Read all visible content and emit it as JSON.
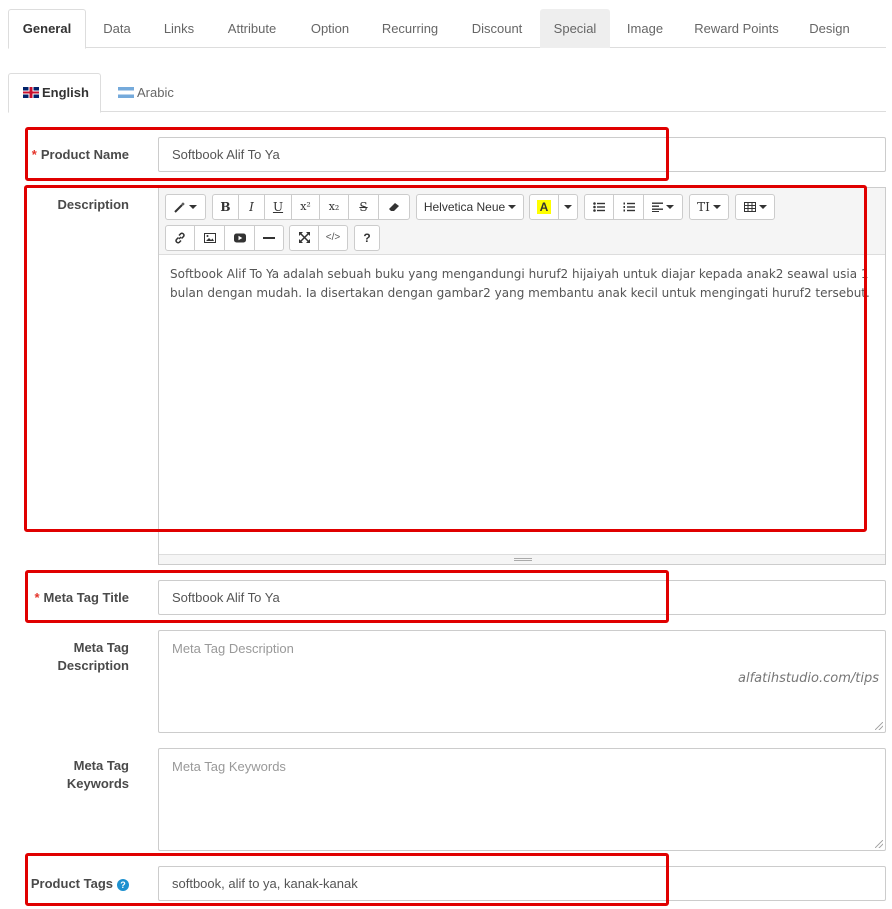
{
  "tabs": [
    {
      "label": "General",
      "active": true
    },
    {
      "label": "Data"
    },
    {
      "label": "Links"
    },
    {
      "label": "Attribute"
    },
    {
      "label": "Option"
    },
    {
      "label": "Recurring"
    },
    {
      "label": "Discount"
    },
    {
      "label": "Special",
      "hovered": true
    },
    {
      "label": "Image"
    },
    {
      "label": "Reward Points"
    },
    {
      "label": "Design"
    }
  ],
  "languages": [
    {
      "label": "English",
      "active": true,
      "flag": "uk-flag-icon"
    },
    {
      "label": "Arabic",
      "flag": "argentina-flag-icon"
    }
  ],
  "form": {
    "product_name": {
      "label": "Product Name",
      "required": "*",
      "value": "Softbook Alif To Ya"
    },
    "description": {
      "label": "Description",
      "text": "Softbook Alif To Ya adalah sebuah buku yang mengandungi huruf2 hijaiyah untuk diajar kepada anak2 seawal usia 1 bulan dengan mudah. Ia disertakan dengan gambar2 yang membantu anak kecil untuk mengingati huruf2 tersebut."
    },
    "meta_title": {
      "label": "Meta Tag Title",
      "required": "*",
      "value": "Softbook Alif To Ya"
    },
    "meta_description": {
      "label_line1": "Meta Tag",
      "label_line2": "Description",
      "placeholder": "Meta Tag Description"
    },
    "meta_keywords": {
      "label": "Meta Tag Keywords",
      "placeholder": "Meta Tag Keywords"
    },
    "product_tags": {
      "label": "Product Tags",
      "help": "?",
      "value": "softbook, alif to ya, kanak-kanak"
    }
  },
  "editor": {
    "toolbar": {
      "style": "style-magic-icon",
      "bold": "B",
      "italic": "I",
      "underline": "U",
      "superscript": "x²",
      "subscript": "x₂",
      "strikethrough": "S",
      "eraser": "eraser-icon",
      "font_name": "Helvetica Neue",
      "color_letter": "A",
      "color_highlight": "#ffff00",
      "unordered_list": "unordered-list-icon",
      "ordered_list": "ordered-list-icon",
      "paragraph": "align-left-icon",
      "height": "TI",
      "table": "table-icon",
      "link": "link-icon",
      "picture": "picture-icon",
      "video": "video-icon",
      "hr": "horizontal-rule-icon",
      "fullscreen": "fullscreen-icon",
      "codeview": "</>",
      "help": "?"
    }
  },
  "watermark": "alfatihstudio.com/tips",
  "colors": {
    "highlight_box": "#e00000",
    "required_star": "#e4342a",
    "help_badge": "#1e91cf"
  }
}
